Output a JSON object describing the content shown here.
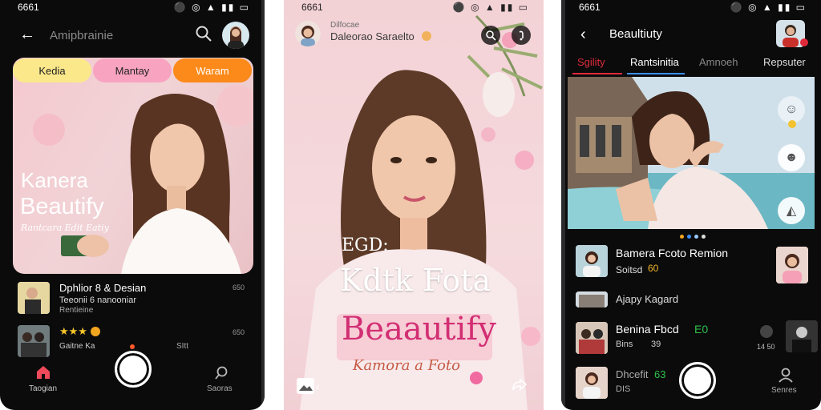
{
  "phone1": {
    "status": {
      "time": "6661"
    },
    "header": {
      "title": "Amipbrainie"
    },
    "pills": [
      {
        "label": "Kedia",
        "color": "#fbe88a"
      },
      {
        "label": "Mantay",
        "color": "#f8a4c1"
      },
      {
        "label": "Waram",
        "color": "#fb8a1a"
      }
    ],
    "hero": {
      "line1": "Kanera",
      "line2": "Beautify",
      "line3": "Rantcara Edit Eatiy"
    },
    "list": [
      {
        "title": "Dphlior 8 & Desian",
        "sub1": "Teeonii 6 nanooniar",
        "sub2": "Rentieine",
        "meta": "650"
      },
      {
        "stars": "★★★",
        "sub1": "Gaitne Ka",
        "meta_mid": "SItt",
        "meta": "650"
      }
    ],
    "nav": {
      "left_label": "Taogian",
      "right_label": "Saoras"
    }
  },
  "phone2": {
    "status": {
      "time": "6661"
    },
    "header": {
      "name": "Dilfocae",
      "sub": "Daleorao Saraelto"
    },
    "overlay": {
      "tag": "EGD:",
      "title": "Kdtk Fota",
      "brand": "Beaautify",
      "sub": "Kamora a Foto"
    }
  },
  "phone3": {
    "status": {
      "time": "6661"
    },
    "header": {
      "title": "Beaultiuty"
    },
    "tabs": [
      "Sgility",
      "Rantsinitia",
      "Amnoeh",
      "Repsuter"
    ],
    "list": [
      {
        "title": "Bamera Fcoto Remion",
        "sub": "Soitsd",
        "badge": "60"
      },
      {
        "title": "Ajapy Kagard"
      },
      {
        "title": "Benina Fbcd",
        "title_accent": "E0",
        "sub": "Bins",
        "sub_meta": "39",
        "meta": "14 50"
      },
      {
        "title": "Dhcefit",
        "title_accent": "63",
        "sub": "DIS"
      }
    ],
    "nav": {
      "right_label": "Senres"
    }
  },
  "colors": {
    "accent_red": "#e02a3a",
    "accent_blue": "#3b8fff",
    "accent_green": "#2fbf4a",
    "brand_pink": "#d22e73"
  }
}
